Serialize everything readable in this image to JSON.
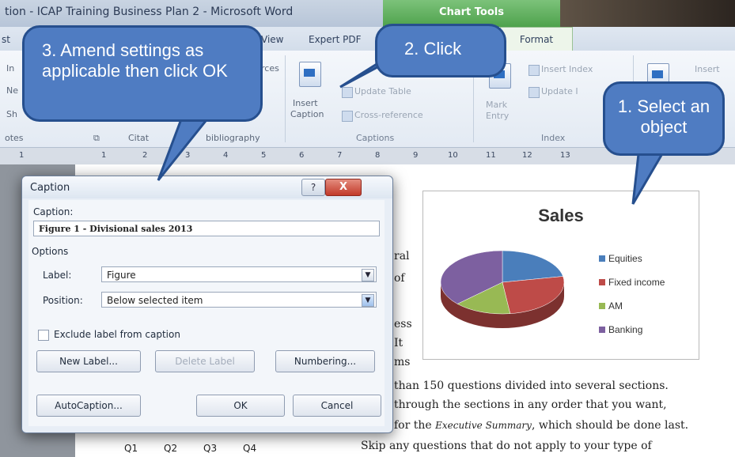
{
  "window": {
    "title": "tion - ICAP Training Business Plan 2 - Microsoft Word",
    "chart_tools_label": "Chart Tools"
  },
  "tabs": {
    "view": "View",
    "expert_pdf": "Expert PDF",
    "format": "Format",
    "partial_left": "st"
  },
  "ribbon": {
    "captions_group": {
      "insert_caption_line1": "Insert",
      "insert_caption_line2": "Caption",
      "update_table": "Update Table",
      "cross_reference": "Cross-reference",
      "group_label": "Captions"
    },
    "index_group": {
      "insert_index": "Insert Index",
      "update_index": "Update I",
      "mark_entry_line1": "Mark",
      "mark_entry_line2": "Entry",
      "group_label": "Index"
    },
    "left_partial": {
      "otes": "otes",
      "citat": "Citat",
      "bibliography": "bibliography",
      "rces": "rces",
      "insert_right": "Insert"
    }
  },
  "ruler_numbers": [
    "1",
    "1",
    "2",
    "3",
    "4",
    "5",
    "6",
    "7",
    "8",
    "9",
    "10",
    "11",
    "12",
    "13"
  ],
  "chart": {
    "chart_data": {
      "type": "pie",
      "title": "Sales",
      "categories": [
        "Equities",
        "Fixed income",
        "AM",
        "Banking"
      ],
      "values": [
        22,
        26,
        15,
        37
      ],
      "colors": [
        "#4a7ebb",
        "#be4b48",
        "#98b954",
        "#7d60a0"
      ],
      "legend_position": "right"
    }
  },
  "dialog": {
    "title": "Caption",
    "help_glyph": "?",
    "close_glyph": "X",
    "caption_label": "Caption:",
    "caption_value": "Figure 1 - Divisional sales 2013",
    "options_label": "Options",
    "label_label": "Label:",
    "label_value": "Figure",
    "position_label": "Position:",
    "position_value": "Below selected item",
    "exclude_label": "Exclude label from caption",
    "new_label_button": "New Label...",
    "delete_label_button": "Delete Label",
    "numbering_button": "Numbering...",
    "autocaption_button": "AutoCaption...",
    "ok_button": "OK",
    "cancel_button": "Cancel"
  },
  "document": {
    "fragments": [
      "ral",
      "of",
      "ess",
      "It",
      "ms"
    ],
    "line1": "than 150 questions divided into several sections.",
    "line2": "through the sections in any order that you want,",
    "line3_pre": "for the ",
    "line3_italic": "Executive Summary",
    "line3_post": ", which should be done last.",
    "line4": "Skip any questions that do not apply to your type of",
    "quarters": [
      "Q1",
      "Q2",
      "Q3",
      "Q4"
    ]
  },
  "callouts": {
    "step1": "1. Select an object",
    "step2": "2. Click",
    "step3": "3. Amend settings as applicable then click OK"
  }
}
